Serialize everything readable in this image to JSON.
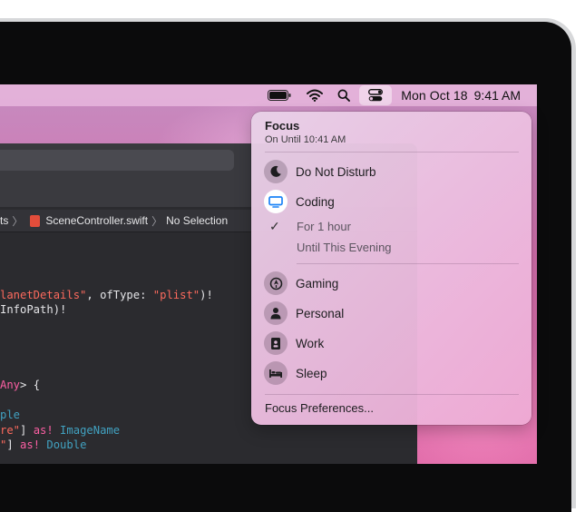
{
  "menubar": {
    "date": "Mon Oct 18",
    "time": "9:41 AM",
    "icons": [
      "battery-icon",
      "wifi-icon",
      "search-icon",
      "control-center-icon"
    ]
  },
  "xcode": {
    "breadcrumb": {
      "parent": "ts",
      "file": "SceneController.swift",
      "selection": "No Selection"
    },
    "code_lines": {
      "l1_str": "lanetDetails\"",
      "l1_mid": ", ofType: ",
      "l1_str2": "\"plist\"",
      "l1_end": ")!",
      "l2": "InfoPath)!",
      "l3_type": "Any",
      "l3_end": "> {",
      "l4": "ple",
      "l5_str": "re\"",
      "l5_mid": "] ",
      "l5_kw": "as!",
      "l5_type": " ImageName",
      "l6_str": "\"",
      "l6_mid": "] ",
      "l6_kw": "as!",
      "l6_type": " Double"
    }
  },
  "focus": {
    "title": "Focus",
    "subtitle": "On Until 10:41 AM",
    "items": [
      {
        "label": "Do Not Disturb",
        "icon": "moon-icon"
      },
      {
        "label": "Coding",
        "icon": "monitor-icon",
        "active": true
      },
      {
        "label": "Gaming",
        "icon": "rocket-icon"
      },
      {
        "label": "Personal",
        "icon": "person-icon"
      },
      {
        "label": "Work",
        "icon": "badge-icon"
      },
      {
        "label": "Sleep",
        "icon": "bed-icon"
      }
    ],
    "coding_options": [
      {
        "label": "For 1 hour",
        "checked": true
      },
      {
        "label": "Until This Evening",
        "checked": false
      }
    ],
    "preferences": "Focus Preferences..."
  },
  "colors": {
    "accent_blue": "#1a82f7",
    "wallpaper_pink": "#e06aa8"
  }
}
